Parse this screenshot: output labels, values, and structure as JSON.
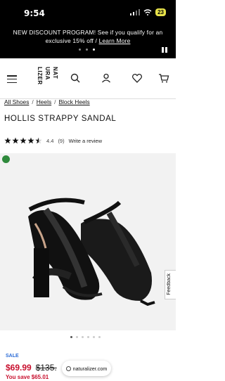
{
  "status": {
    "time": "9:54",
    "battery": "23"
  },
  "promo": {
    "text": "NEW DISCOUNT PROGRAM! See if you qualify for an exclusive 15% off / ",
    "link": "Learn More"
  },
  "logo": {
    "col1": "NAT",
    "col2": "URA",
    "col3": "LIZER"
  },
  "breadcrumb": [
    "All Shoes",
    "Heels",
    "Block Heels"
  ],
  "product": {
    "title": "HOLLIS STRAPPY SANDAL",
    "rating": 4.4,
    "rating_text": "4.4",
    "review_count": "(9)",
    "write_review": "Write a review",
    "sale_label": "SALE",
    "sale_price": "$69.99",
    "original_price": "$135.",
    "you_save": "You save $65.01"
  },
  "feedback": "Feedback",
  "url": "naturalizer.com",
  "colors": {
    "accent_red": "#c8102e",
    "sale_blue": "#2b6bd6",
    "eco_green": "#2f8a3c"
  }
}
